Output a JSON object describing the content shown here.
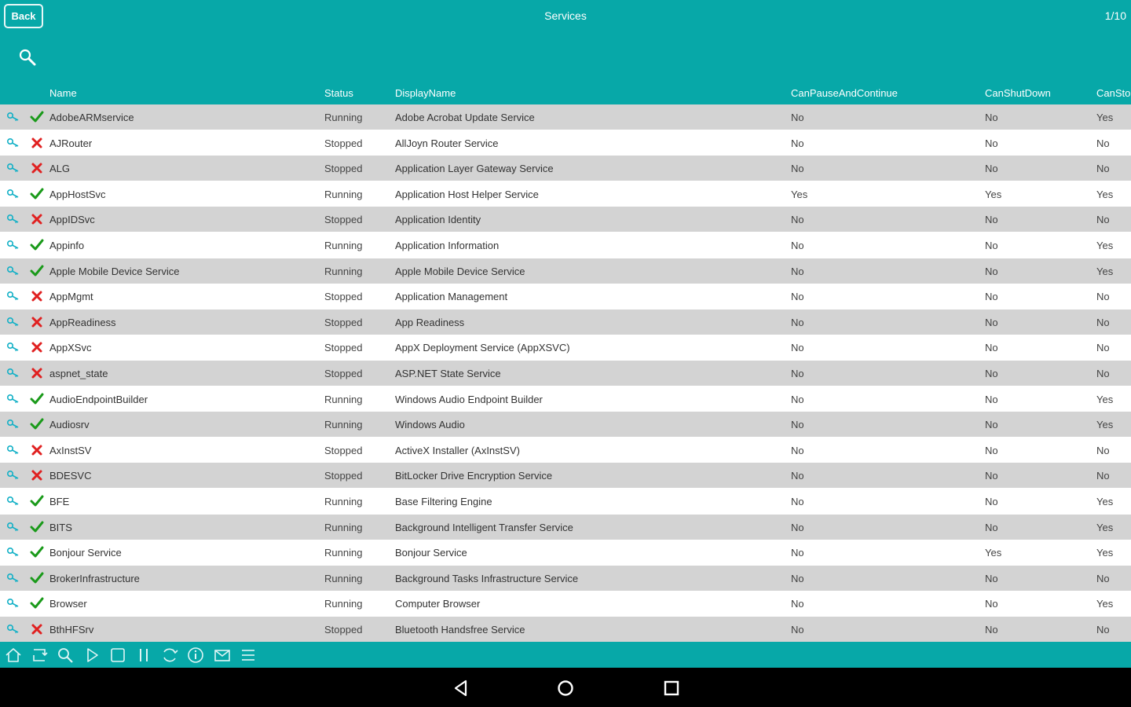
{
  "topbar": {
    "back_label": "Back",
    "title": "Services",
    "pager": "1/10",
    "search_icon": "search-icon"
  },
  "colors": {
    "accent": "#07a8a8",
    "row_alt": "#d3d3d3",
    "running_check": "#1a9a1a",
    "stopped_x": "#e02020"
  },
  "table": {
    "headers": {
      "name": "Name",
      "status": "Status",
      "display": "DisplayName",
      "pause": "CanPauseAndContinue",
      "shutdown": "CanShutDown",
      "stop": "CanSto"
    },
    "rows": [
      {
        "name": "AdobeARMservice",
        "status": "Running",
        "display": "Adobe Acrobat Update Service",
        "pause": "No",
        "shutdown": "No",
        "stop": "Yes"
      },
      {
        "name": "AJRouter",
        "status": "Stopped",
        "display": "AllJoyn Router Service",
        "pause": "No",
        "shutdown": "No",
        "stop": "No"
      },
      {
        "name": "ALG",
        "status": "Stopped",
        "display": "Application Layer Gateway Service",
        "pause": "No",
        "shutdown": "No",
        "stop": "No"
      },
      {
        "name": "AppHostSvc",
        "status": "Running",
        "display": "Application Host Helper Service",
        "pause": "Yes",
        "shutdown": "Yes",
        "stop": "Yes"
      },
      {
        "name": "AppIDSvc",
        "status": "Stopped",
        "display": "Application Identity",
        "pause": "No",
        "shutdown": "No",
        "stop": "No"
      },
      {
        "name": "Appinfo",
        "status": "Running",
        "display": "Application Information",
        "pause": "No",
        "shutdown": "No",
        "stop": "Yes"
      },
      {
        "name": "Apple Mobile Device Service",
        "status": "Running",
        "display": "Apple Mobile Device Service",
        "pause": "No",
        "shutdown": "No",
        "stop": "Yes"
      },
      {
        "name": "AppMgmt",
        "status": "Stopped",
        "display": "Application Management",
        "pause": "No",
        "shutdown": "No",
        "stop": "No"
      },
      {
        "name": "AppReadiness",
        "status": "Stopped",
        "display": "App Readiness",
        "pause": "No",
        "shutdown": "No",
        "stop": "No"
      },
      {
        "name": "AppXSvc",
        "status": "Stopped",
        "display": "AppX Deployment Service (AppXSVC)",
        "pause": "No",
        "shutdown": "No",
        "stop": "No"
      },
      {
        "name": "aspnet_state",
        "status": "Stopped",
        "display": "ASP.NET State Service",
        "pause": "No",
        "shutdown": "No",
        "stop": "No"
      },
      {
        "name": "AudioEndpointBuilder",
        "status": "Running",
        "display": "Windows Audio Endpoint Builder",
        "pause": "No",
        "shutdown": "No",
        "stop": "Yes"
      },
      {
        "name": "Audiosrv",
        "status": "Running",
        "display": "Windows Audio",
        "pause": "No",
        "shutdown": "No",
        "stop": "Yes"
      },
      {
        "name": "AxInstSV",
        "status": "Stopped",
        "display": "ActiveX Installer (AxInstSV)",
        "pause": "No",
        "shutdown": "No",
        "stop": "No"
      },
      {
        "name": "BDESVC",
        "status": "Stopped",
        "display": "BitLocker Drive Encryption Service",
        "pause": "No",
        "shutdown": "No",
        "stop": "No"
      },
      {
        "name": "BFE",
        "status": "Running",
        "display": "Base Filtering Engine",
        "pause": "No",
        "shutdown": "No",
        "stop": "Yes"
      },
      {
        "name": "BITS",
        "status": "Running",
        "display": "Background Intelligent Transfer Service",
        "pause": "No",
        "shutdown": "No",
        "stop": "Yes"
      },
      {
        "name": "Bonjour Service",
        "status": "Running",
        "display": "Bonjour Service",
        "pause": "No",
        "shutdown": "Yes",
        "stop": "Yes"
      },
      {
        "name": "BrokerInfrastructure",
        "status": "Running",
        "display": "Background Tasks Infrastructure Service",
        "pause": "No",
        "shutdown": "No",
        "stop": "No"
      },
      {
        "name": "Browser",
        "status": "Running",
        "display": "Computer Browser",
        "pause": "No",
        "shutdown": "No",
        "stop": "Yes"
      },
      {
        "name": "BthHFSrv",
        "status": "Stopped",
        "display": "Bluetooth Handsfree Service",
        "pause": "No",
        "shutdown": "No",
        "stop": "No"
      }
    ]
  },
  "toolbar": {
    "icons": [
      "home-icon",
      "refresh-icon",
      "search-icon",
      "start-icon",
      "stop-icon",
      "pause-icon",
      "restart-icon",
      "info-icon",
      "email-icon",
      "menu-icon"
    ]
  },
  "navbar": {
    "icons": [
      "back-nav-icon",
      "home-nav-icon",
      "recents-nav-icon"
    ]
  }
}
